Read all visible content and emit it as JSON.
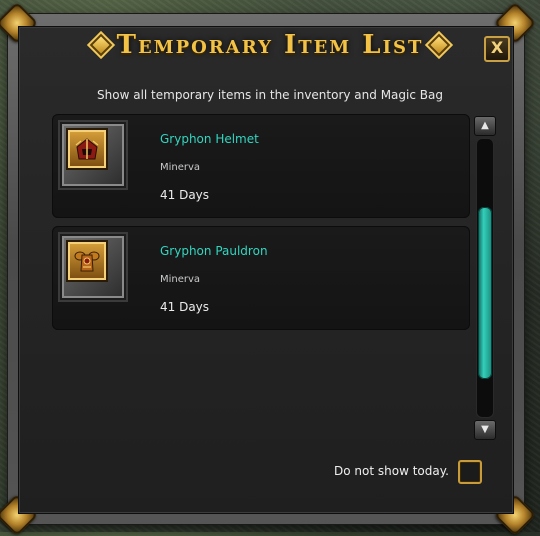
{
  "window": {
    "title": "Temporary Item List",
    "subtitle": "Show all temporary items in the inventory and Magic Bag",
    "close_label": "X"
  },
  "items": [
    {
      "name": "Gryphon Helmet",
      "server": "Minerva",
      "duration": "41 Days",
      "icon": "gryphon-helmet-icon"
    },
    {
      "name": "Gryphon Pauldron",
      "server": "Minerva",
      "duration": "41 Days",
      "icon": "gryphon-pauldron-icon"
    }
  ],
  "scrollbar": {
    "up_label": "▲",
    "down_label": "▼",
    "position_fraction": 0.65
  },
  "footer": {
    "do_not_show_label": "Do not show today.",
    "checked": false
  },
  "colors": {
    "title_gold": "#f2c246",
    "item_name_teal": "#31d6c0",
    "scroll_thumb_teal": "#33d0bb",
    "accent_gold": "#c99b39"
  }
}
